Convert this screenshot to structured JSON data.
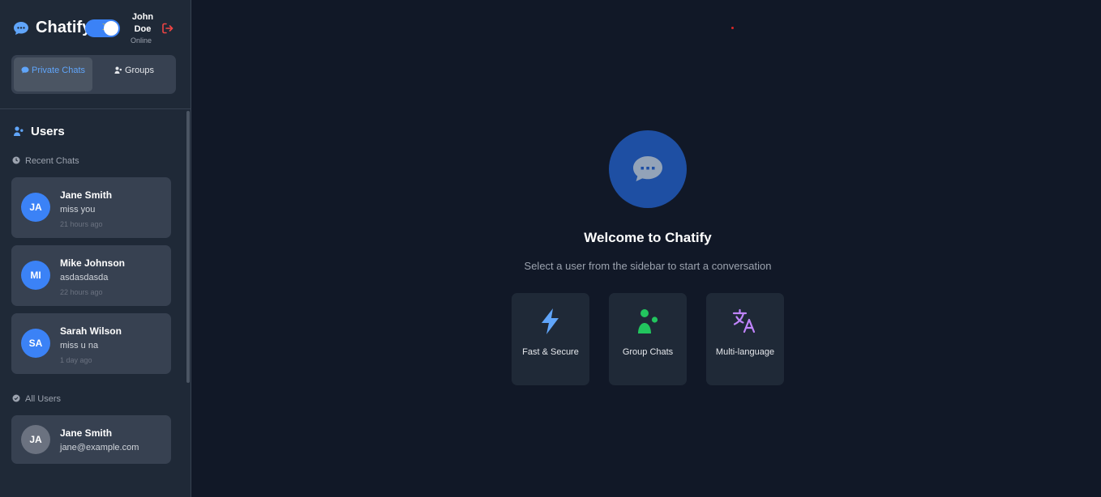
{
  "app": {
    "name": "Chatify",
    "theme_toggle_icon": "moon-icon"
  },
  "user": {
    "name": "John Doe",
    "status": "Online"
  },
  "tabs": [
    {
      "label": "Private Chats",
      "icon": "chat-icon",
      "active": true
    },
    {
      "label": "Groups",
      "icon": "users-icon",
      "active": false
    }
  ],
  "sidebar": {
    "section_title": "Users",
    "recent_label": "Recent Chats",
    "all_users_label": "All Users",
    "recent_chats": [
      {
        "initials": "JA",
        "name": "Jane Smith",
        "message": "miss you",
        "time": "21 hours ago"
      },
      {
        "initials": "MI",
        "name": "Mike Johnson",
        "message": "asdasdasda",
        "time": "22 hours ago"
      },
      {
        "initials": "SA",
        "name": "Sarah Wilson",
        "message": "miss u na",
        "time": "1 day ago"
      }
    ],
    "all_users": [
      {
        "initials": "JA",
        "name": "Jane Smith",
        "email": "jane@example.com"
      }
    ]
  },
  "main": {
    "welcome_title": "Welcome to Chatify",
    "welcome_subtitle": "Select a user from the sidebar to start a conversation",
    "features": [
      {
        "label": "Fast & Secure",
        "icon": "bolt-icon",
        "color": "#60a5fa"
      },
      {
        "label": "Group Chats",
        "icon": "users-icon",
        "color": "#22c55e"
      },
      {
        "label": "Multi-language",
        "icon": "language-icon",
        "color": "#c084fc"
      }
    ]
  },
  "colors": {
    "accent": "#3b82f6",
    "background": "#111827",
    "sidebar": "#1f2937",
    "danger": "#ef4444"
  }
}
